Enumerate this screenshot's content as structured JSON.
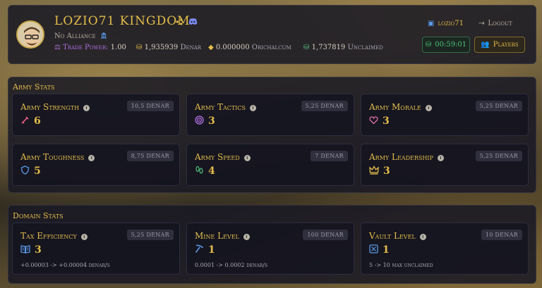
{
  "header": {
    "kingdom_title": "LOZIO71 KINGDOM",
    "alliance": "No Alliance",
    "trade_power_label": "Trade Power:",
    "trade_power_value": "1.00",
    "denar_value": "1,935939",
    "denar_unit": "Denar",
    "orichalcum_value": "0.000000",
    "orichalcum_unit": "Orichalcum",
    "unclaimed_value": "1,737819",
    "unclaimed_unit": "Unclaimed",
    "user_name": "lozio71",
    "logout_label": "Logout",
    "timer": "00:59:01",
    "players_label": "Players"
  },
  "army": {
    "section_title": "Army Stats",
    "cards": [
      {
        "title": "Army Strength",
        "cost": "10,5 DENAR",
        "level": "6",
        "icon": "sword-icon",
        "color": "#e25a7a"
      },
      {
        "title": "Army Tactics",
        "cost": "5,25 DENAR",
        "level": "3",
        "icon": "target-icon",
        "color": "#b070e0"
      },
      {
        "title": "Army Morale",
        "cost": "5,25 DENAR",
        "level": "3",
        "icon": "heart-icon",
        "color": "#e070a8"
      },
      {
        "title": "Army Toughness",
        "cost": "8,75 DENAR",
        "level": "5",
        "icon": "shield-icon",
        "color": "#5a9ae8"
      },
      {
        "title": "Army Speed",
        "cost": "7 DENAR",
        "level": "4",
        "icon": "footprints-icon",
        "color": "#4ec07a"
      },
      {
        "title": "Army Leadership",
        "cost": "5,25 DENAR",
        "level": "3",
        "icon": "crown-icon",
        "color": "#e3bd4a"
      }
    ]
  },
  "domain": {
    "section_title": "Domain Stats",
    "cards": [
      {
        "title": "Tax Efficiency",
        "cost": "5,25 DENAR",
        "level": "3",
        "icon": "book-icon",
        "color": "#5a9ae8",
        "rate": "+0.00003 -> +0.00004 denar/s"
      },
      {
        "title": "Mine Level",
        "cost": "100 DENAR",
        "level": "1",
        "icon": "pickaxe-icon",
        "color": "#5a9ae8",
        "rate": "0.0001 -> 0.0002 denar/s"
      },
      {
        "title": "Vault Level",
        "cost": "10 DENAR",
        "level": "1",
        "icon": "vault-icon",
        "color": "#5a9ae8",
        "rate": "5 -> 10 max unclaimed"
      }
    ]
  },
  "colors": {
    "gold": "#e3bd4a",
    "green": "#4ec07a",
    "purple": "#b070e0",
    "panel": "#181824"
  }
}
